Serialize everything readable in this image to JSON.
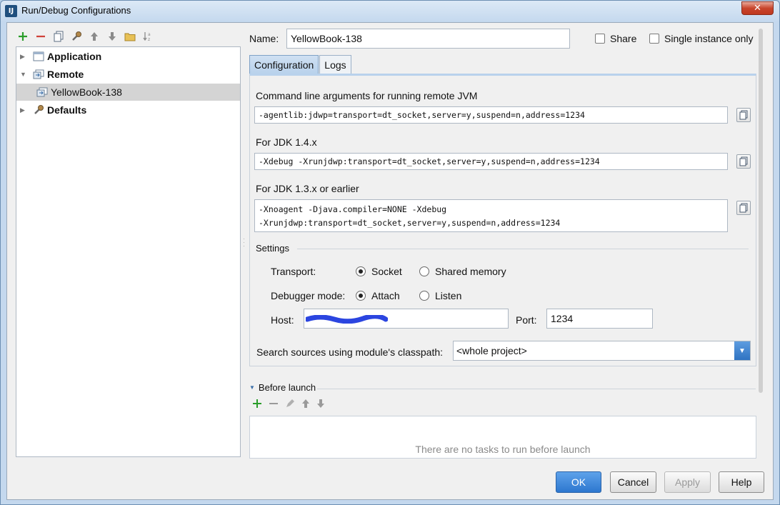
{
  "window": {
    "title": "Run/Debug Configurations",
    "app_icon": "IJ",
    "close_glyph": "✕"
  },
  "tree": {
    "items": [
      {
        "label": "Application",
        "icon": "application-icon"
      },
      {
        "label": "Remote",
        "icon": "remote-icon"
      },
      {
        "label": "YellowBook-138",
        "icon": "remote-config-icon"
      },
      {
        "label": "Defaults",
        "icon": "wrench-icon"
      }
    ]
  },
  "form": {
    "name_label": "Name:",
    "name_value": "YellowBook-138",
    "share_label": "Share",
    "single_instance_label": "Single instance only"
  },
  "tabs": [
    {
      "label": "Configuration",
      "active": true
    },
    {
      "label": "Logs",
      "active": false
    }
  ],
  "config": {
    "cmdline_label": "Command line arguments for running remote JVM",
    "cmdline_value": "-agentlib:jdwp=transport=dt_socket,server=y,suspend=n,address=1234",
    "jdk14_label": "For JDK 1.4.x",
    "jdk14_value": "-Xdebug -Xrunjdwp:transport=dt_socket,server=y,suspend=n,address=1234",
    "jdk13_label": "For JDK 1.3.x or earlier",
    "jdk13_line1": "-Xnoagent -Djava.compiler=NONE -Xdebug",
    "jdk13_line2": "-Xrunjdwp:transport=dt_socket,server=y,suspend=n,address=1234",
    "settings_label": "Settings",
    "transport_label": "Transport:",
    "transport_socket": "Socket",
    "transport_shared": "Shared memory",
    "debugger_label": "Debugger mode:",
    "debugger_attach": "Attach",
    "debugger_listen": "Listen",
    "host_label": "Host:",
    "host_value": "",
    "port_label": "Port:",
    "port_value": "1234",
    "search_label": "Search sources using module's classpath:",
    "search_value": "<whole project>"
  },
  "before_launch": {
    "label": "Before launch",
    "empty_message": "There are no tasks to run before launch"
  },
  "buttons": {
    "ok": "OK",
    "cancel": "Cancel",
    "apply": "Apply",
    "help": "Help"
  },
  "colors": {
    "accent": "#2d77cf",
    "add_green": "#2a9d2a",
    "remove_red": "#d0423a",
    "redaction_blue": "#2b45e0"
  }
}
